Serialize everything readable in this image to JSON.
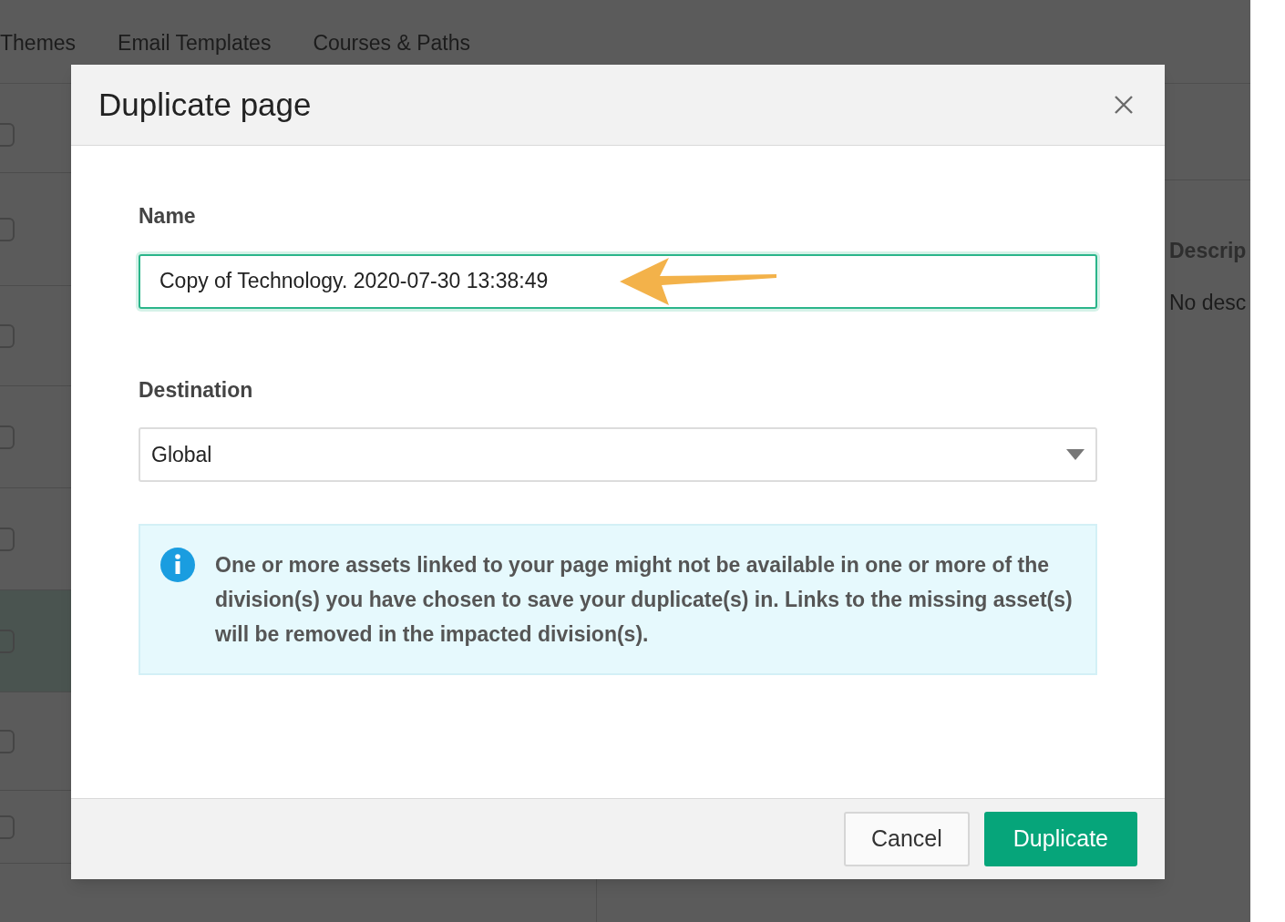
{
  "nav_tabs": [
    "Themes",
    "Email Templates",
    "Courses & Paths"
  ],
  "list_rows": [
    {
      "selected": false
    },
    {
      "selected": false
    },
    {
      "selected": false
    },
    {
      "selected": false
    },
    {
      "selected": false
    },
    {
      "selected": true
    },
    {
      "selected": false
    },
    {
      "selected": false
    }
  ],
  "detail_panel": {
    "heading": "Descrip",
    "text": "No desc"
  },
  "dialog": {
    "title": "Duplicate page",
    "name_label": "Name",
    "name_value": "Copy of Technology. 2020-07-30 13:38:49",
    "destination_label": "Destination",
    "destination_value": "Global",
    "info_message": "One or more assets linked to your page might not be available in one or more of the division(s) you have chosen to save your duplicate(s) in. Links to the missing asset(s) will be removed in the impacted division(s).",
    "buttons": [
      {
        "label": "Cancel",
        "kind": "secondary"
      },
      {
        "label": "Duplicate",
        "kind": "primary"
      }
    ]
  }
}
